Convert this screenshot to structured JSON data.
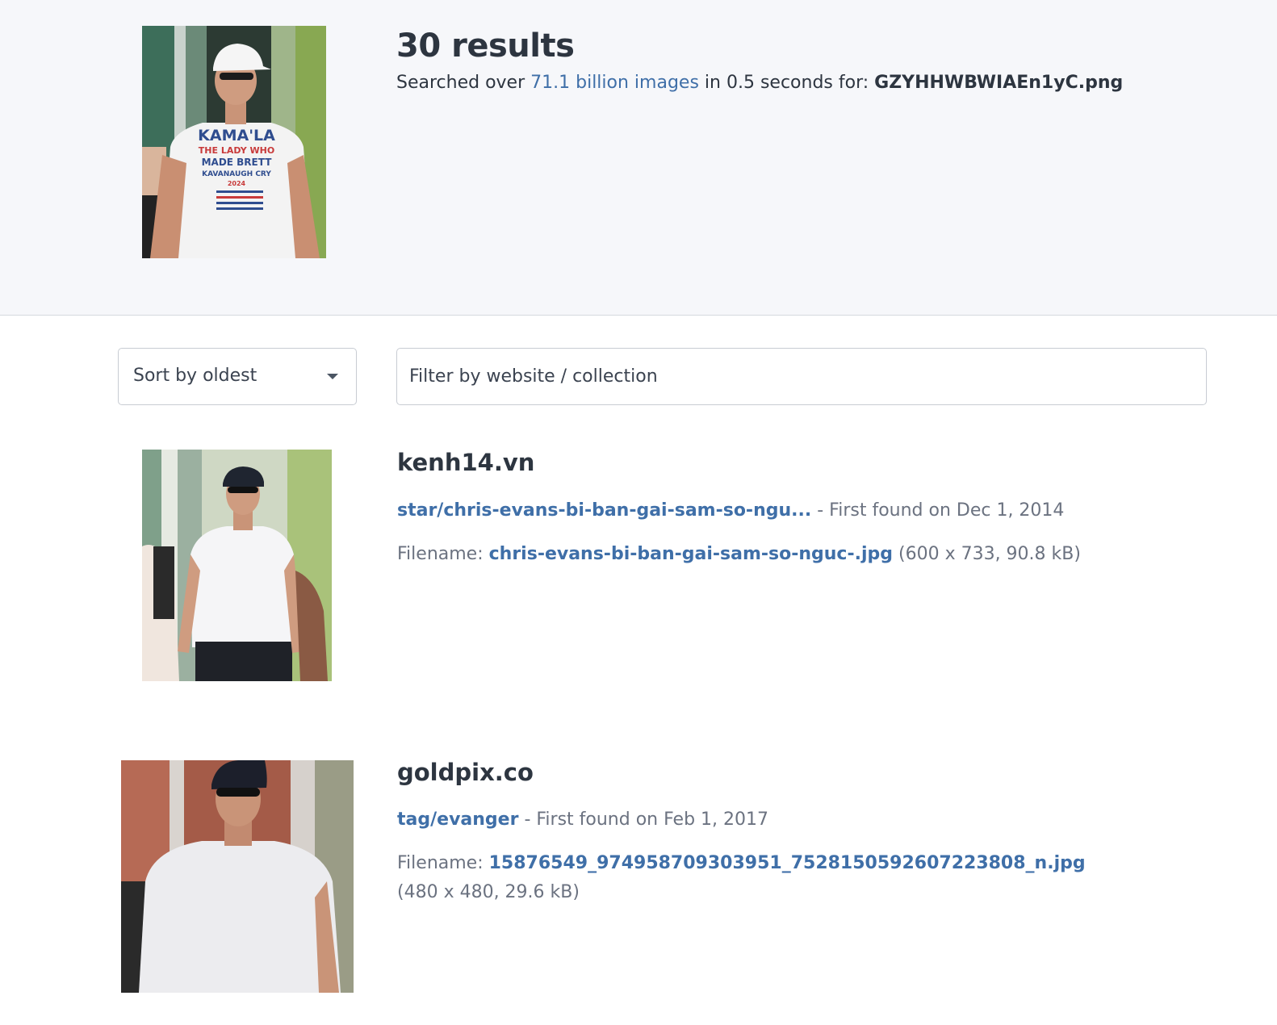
{
  "header": {
    "results_count": "30 results",
    "summary_prefix": "Searched over",
    "summary_link": "71.1 billion images",
    "summary_middle": "in 0.5 seconds for:",
    "query_filename": "GZYHHWBWIAEn1yC.png",
    "query_shirt_text": [
      "KAMA'LA",
      "THE LADY WHO",
      "MADE BRETT",
      "KAVANAUGH CRY",
      "2024"
    ]
  },
  "controls": {
    "sort_label": "Sort by oldest",
    "filter_placeholder": "Filter by website / collection"
  },
  "results": [
    {
      "site": "kenh14.vn",
      "path": "star/chris-evans-bi-ban-gai-sam-so-ngu...",
      "first_found": "- First found on Dec 1, 2014",
      "filename_label": "Filename:",
      "filename": "chris-evans-bi-ban-gai-sam-so-nguc-.jpg",
      "size": "(600 x 733, 90.8 kB)"
    },
    {
      "site": "goldpix.co",
      "path": "tag/evanger",
      "first_found": "- First found on Feb 1, 2017",
      "filename_label": "Filename:",
      "filename": "15876549_974958709303951_7528150592607223808_n.jpg",
      "size": "(480 x 480, 29.6 kB)"
    }
  ],
  "colors": {
    "link": "#3f6fa8",
    "header_bg": "#f6f7fa",
    "text": "#2d3540",
    "muted": "#6b7280"
  }
}
